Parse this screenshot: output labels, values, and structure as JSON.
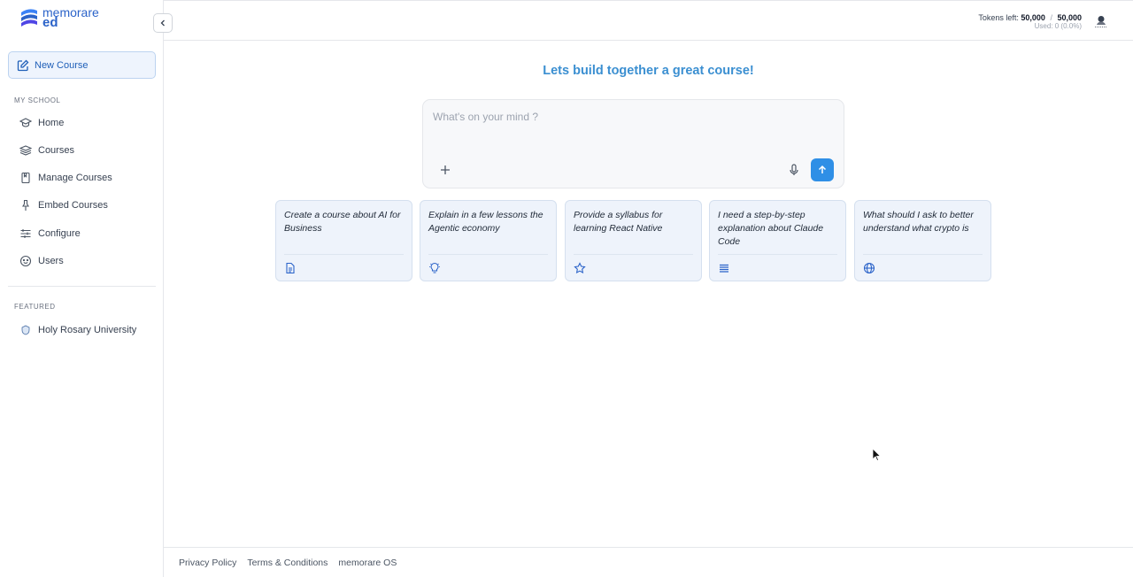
{
  "brand": {
    "line1": "memorare",
    "line2": "ed"
  },
  "sidebar": {
    "new_course_label": "New Course",
    "section_my_school": "MY SCHOOL",
    "items": [
      {
        "label": "Home",
        "icon": "graduation-cap-icon"
      },
      {
        "label": "Courses",
        "icon": "layers-icon"
      },
      {
        "label": "Manage Courses",
        "icon": "bookmark-icon"
      },
      {
        "label": "Embed Courses",
        "icon": "pin-icon"
      },
      {
        "label": "Configure",
        "icon": "sliders-icon"
      },
      {
        "label": "Users",
        "icon": "smile-icon"
      }
    ],
    "section_featured": "FEATURED",
    "featured": [
      {
        "label": "Holy Rosary University"
      }
    ]
  },
  "header": {
    "tokens_label": "Tokens left:",
    "tokens_left": "50,000",
    "tokens_separator": "/",
    "tokens_total": "50,000",
    "used_text": "Used: 0 (0.0%)"
  },
  "main": {
    "title": "Lets build together a great course!",
    "prompt_placeholder": "What's on your mind ?",
    "suggestions": [
      {
        "text": "Create a course about AI for Business",
        "icon": "document-icon"
      },
      {
        "text": "Explain in a few lessons the Agentic economy",
        "icon": "lightbulb-icon"
      },
      {
        "text": "Provide a syllabus for learning React Native",
        "icon": "star-icon"
      },
      {
        "text": "I need a step-by-step explanation about Claude Code",
        "icon": "list-icon"
      },
      {
        "text": "What should I ask to better understand what crypto is",
        "icon": "globe-icon"
      }
    ]
  },
  "footer": {
    "links": [
      "Privacy Policy",
      "Terms & Conditions",
      "memorare OS"
    ]
  },
  "colors": {
    "accent": "#2f8fe6",
    "title": "#3b8fd1",
    "brand": "#2b63c9"
  }
}
